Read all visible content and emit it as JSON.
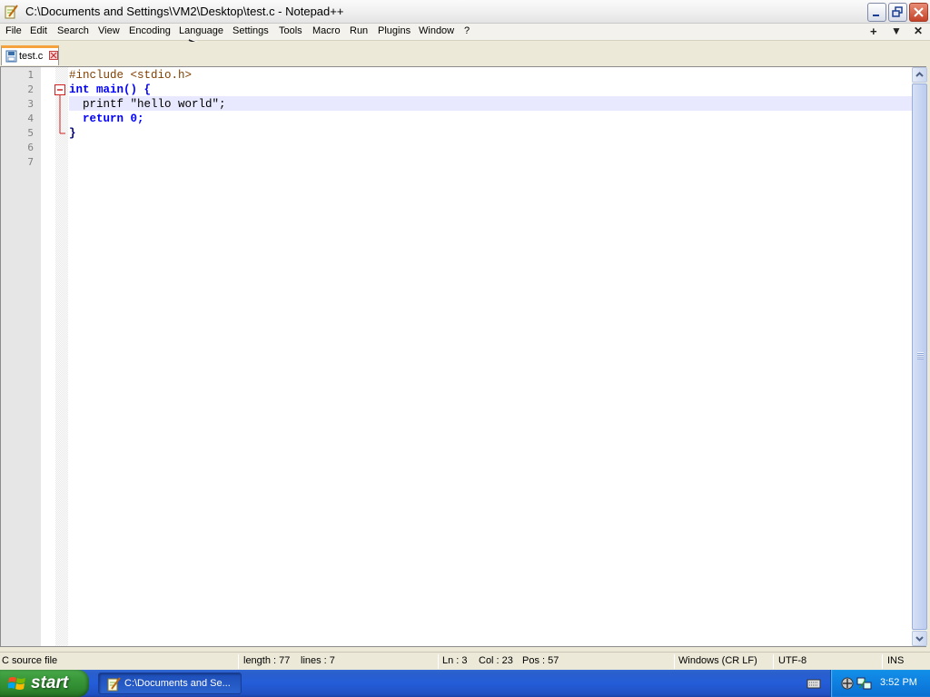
{
  "window": {
    "title": "C:\\Documents and Settings\\VM2\\Desktop\\test.c - Notepad++",
    "controls": {
      "minimize_icon": "minimize-icon",
      "restore_icon": "restore-icon",
      "close_icon": "close-icon"
    }
  },
  "menu": {
    "items": [
      "File",
      "Edit",
      "Search",
      "View",
      "Encoding",
      "Language",
      "Settings",
      "Tools",
      "Macro",
      "Run",
      "Plugins",
      "Window",
      "?"
    ],
    "right_controls": [
      "+",
      "▼",
      "✕"
    ]
  },
  "tabs": [
    {
      "label": "test.c",
      "active": true
    }
  ],
  "editor": {
    "line_numbers": [
      "1",
      "2",
      "3",
      "4",
      "5",
      "6",
      "7"
    ],
    "lines": [
      "#include <stdio.h>",
      "int main() {",
      "  printf \"hello world\";",
      "  return 0;",
      "}",
      "",
      ""
    ],
    "current_line": 3
  },
  "statusbar": {
    "file_type": "C source file",
    "length": "length : 77",
    "lines": "lines : 7",
    "ln": "Ln : 3",
    "col": "Col : 23",
    "pos": "Pos : 57",
    "eol": "Windows (CR LF)",
    "encoding": "UTF-8",
    "mode": "INS"
  },
  "taskbar": {
    "start_label": "start",
    "task_label": "C:\\Documents and Se...",
    "clock": "3:52 PM"
  },
  "colors": {
    "keyword": "#0000ff",
    "preprocessor": "#804000",
    "string": "#808080",
    "number": "#ff8000",
    "current_line": "#e8e8ff",
    "tab_accent": "#f6a23c",
    "taskbar": "#245dd9",
    "start_button": "#3b9a3c"
  }
}
